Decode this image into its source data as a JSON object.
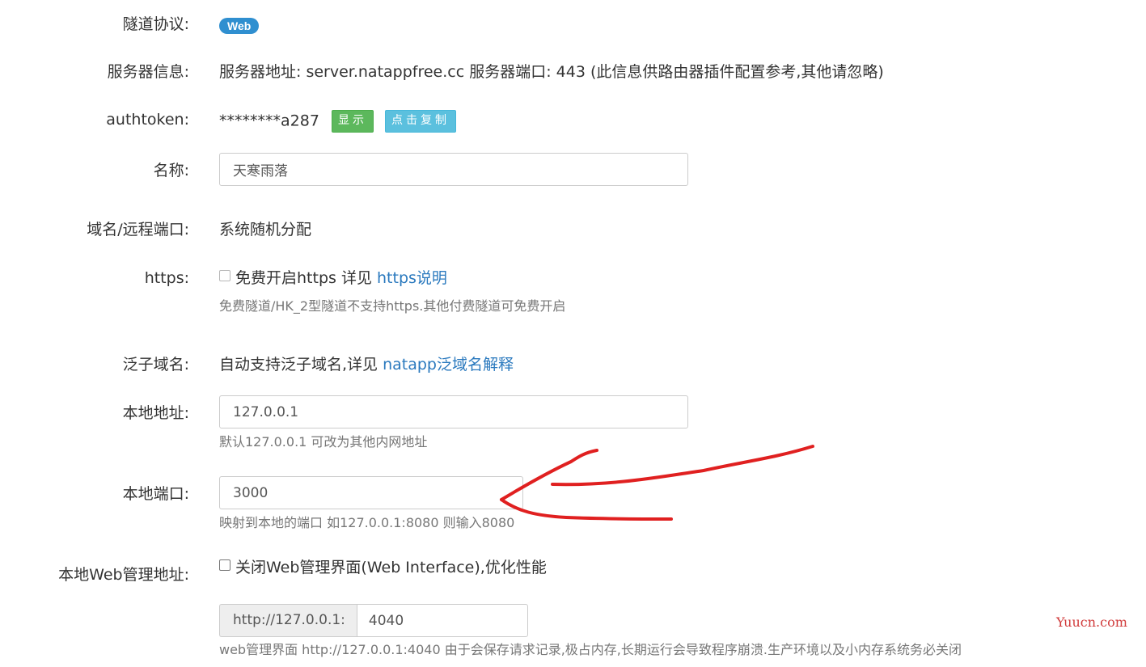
{
  "tunnel_protocol": {
    "label": "隧道协议:",
    "badge": "Web"
  },
  "server_info": {
    "label": "服务器信息:",
    "text": "服务器地址: server.natappfree.cc 服务器端口: 443 (此信息供路由器插件配置参考,其他请忽略)"
  },
  "authtoken": {
    "label": "authtoken:",
    "masked_value": "********a287",
    "show_button": "显示",
    "copy_button": "点击复制"
  },
  "name": {
    "label": "名称:",
    "value": "天寒雨落"
  },
  "domain_port": {
    "label": "域名/远程端口:",
    "text": "系统随机分配"
  },
  "https": {
    "label": "https:",
    "checkbox_text": "免费开启https 详见",
    "link_text": "https说明",
    "help": "免费隧道/HK_2型隧道不支持https.其他付费隧道可免费开启"
  },
  "wildcard_domain": {
    "label": "泛子域名:",
    "text": "自动支持泛子域名,详见",
    "link_text": "natapp泛域名解释"
  },
  "local_address": {
    "label": "本地地址:",
    "value": "127.0.0.1",
    "help": "默认127.0.0.1 可改为其他内网地址"
  },
  "local_port": {
    "label": "本地端口:",
    "value": "3000",
    "help": "映射到本地的端口 如127.0.0.1:8080 则输入8080"
  },
  "local_web_admin": {
    "label": "本地Web管理地址:",
    "checkbox_text": "关闭Web管理界面(Web Interface),优化性能",
    "addon": "http://127.0.0.1:",
    "port_value": "4040",
    "help": "web管理界面 http://127.0.0.1:4040 由于会保存请求记录,极占内存,长期运行会导致程序崩溃.生产环境以及小内存系统务必关闭"
  },
  "watermark": "Yuucn.com",
  "colors": {
    "badge": "#2f8fd0",
    "show_button": "#5cb85c",
    "copy_button": "#5bc0de",
    "link": "#2a79be",
    "annotation_stroke": "#e02020"
  }
}
